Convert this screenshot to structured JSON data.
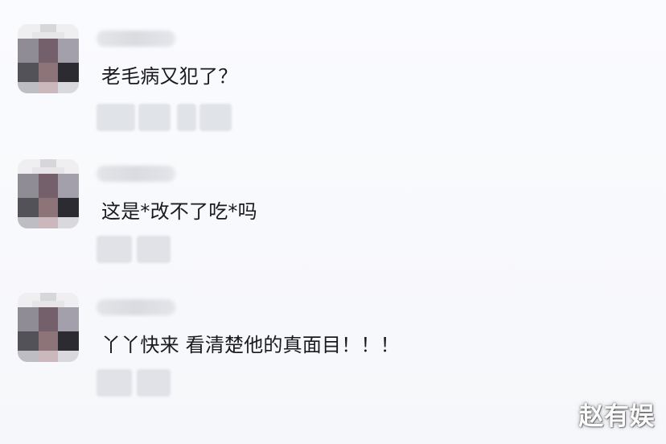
{
  "comments": [
    {
      "text": "老毛病又犯了？"
    },
    {
      "text": "这是*改不了吃*吗"
    },
    {
      "text": "丫丫快来 看清楚他的真面目！！！"
    }
  ],
  "watermark": "赵有娱"
}
